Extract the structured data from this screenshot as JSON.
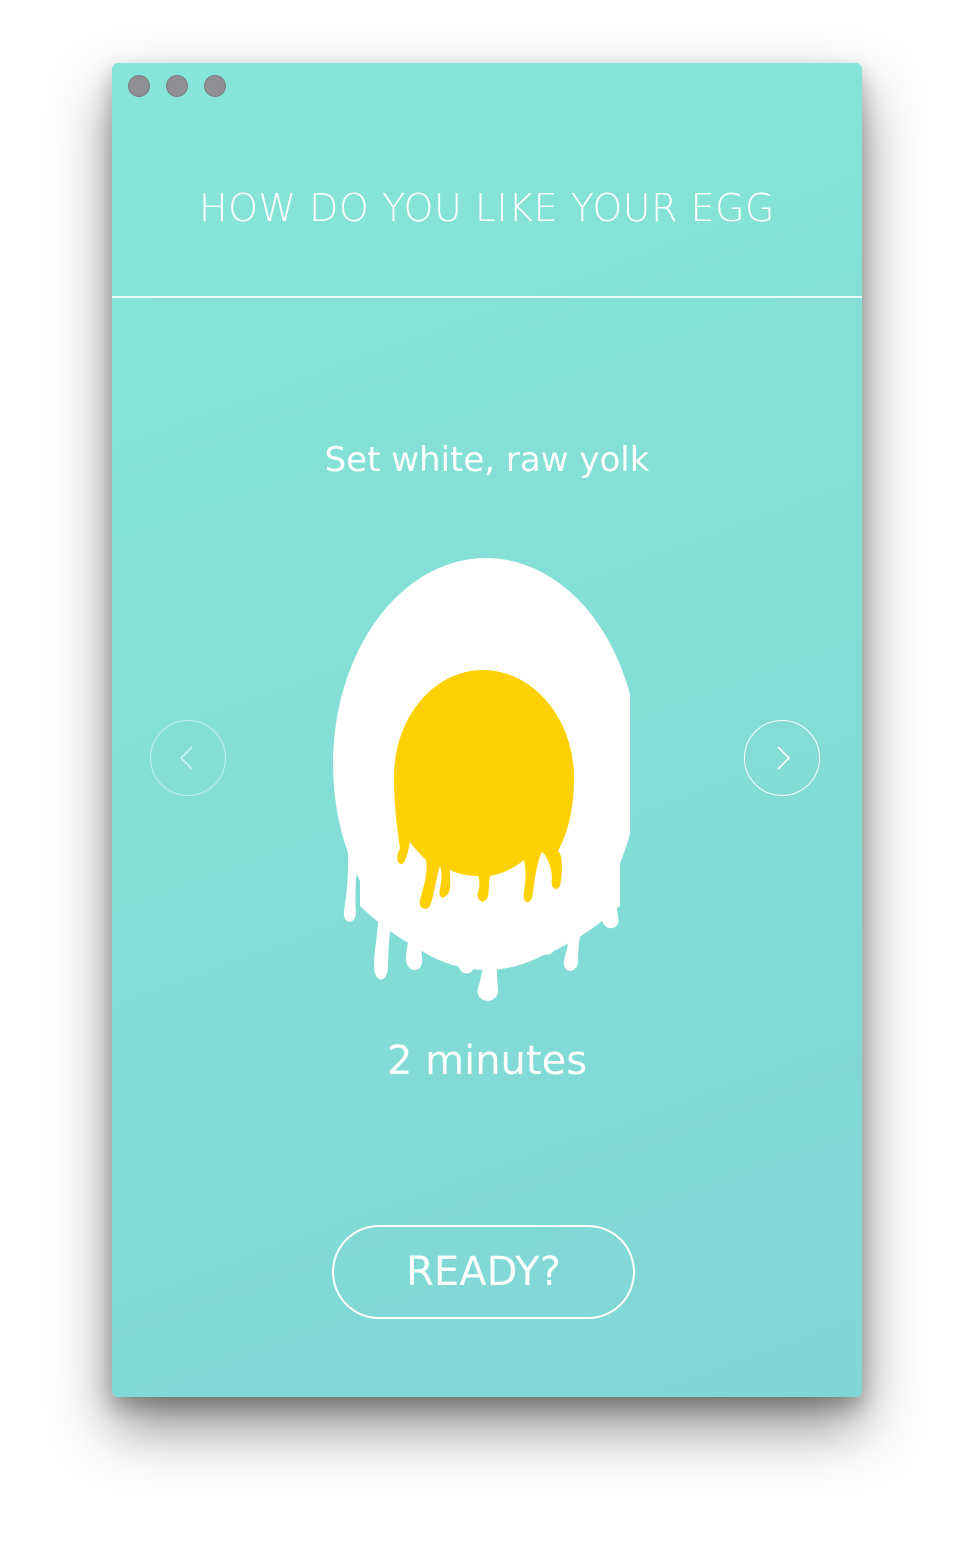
{
  "window": {
    "controls": [
      "close",
      "minimize",
      "zoom"
    ]
  },
  "header": {
    "title": "HOW DO YOU LIKE YOUR EGG"
  },
  "selection": {
    "label": "Set white, raw yolk",
    "duration": "2 minutes",
    "illustration": "soft-boiled-egg-icon"
  },
  "navigation": {
    "prev_icon": "chevron-left-icon",
    "next_icon": "chevron-right-icon"
  },
  "action": {
    "ready_label": "READY?"
  },
  "colors": {
    "background_start": "#86e5d8",
    "background_end": "#80d6d6",
    "egg_white": "#ffffff",
    "yolk": "#fed105",
    "control_dot": "#8e8e93"
  }
}
